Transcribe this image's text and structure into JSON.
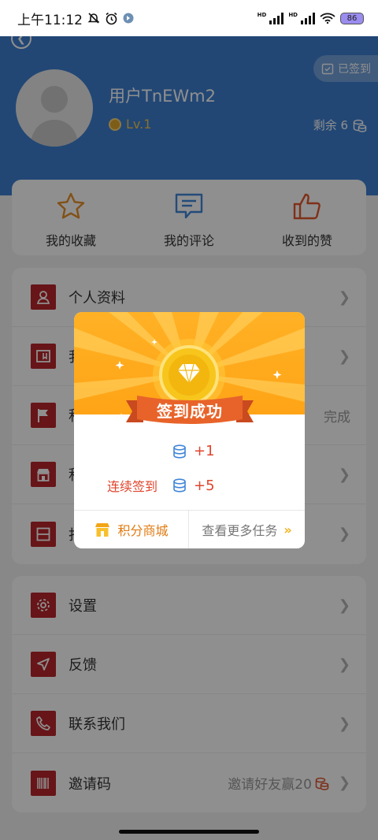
{
  "status_bar": {
    "time": "上午11:12",
    "battery": "86"
  },
  "profile": {
    "username": "用户TnEWm2",
    "level": "Lv.1",
    "checked_in_label": "已签到",
    "remaining_label": "剩余 6"
  },
  "quick_actions": [
    {
      "label": "我的收藏",
      "icon": "star-icon"
    },
    {
      "label": "我的评论",
      "icon": "comment-icon"
    },
    {
      "label": "收到的赞",
      "icon": "thumbs-up-icon"
    }
  ],
  "menu1": [
    {
      "label": "个人资料",
      "icon": "user-icon",
      "extra": ""
    },
    {
      "label": "我",
      "icon": "folder-icon",
      "extra": ""
    },
    {
      "label": "积",
      "icon": "flag-icon",
      "extra": "完成"
    },
    {
      "label": "积",
      "icon": "shop-icon",
      "extra": ""
    },
    {
      "label": "打",
      "icon": "square-icon",
      "extra": ""
    }
  ],
  "menu2": [
    {
      "label": "设置",
      "icon": "gear-icon",
      "extra": ""
    },
    {
      "label": "反馈",
      "icon": "send-icon",
      "extra": ""
    },
    {
      "label": "联系我们",
      "icon": "phone-icon",
      "extra": ""
    },
    {
      "label": "邀请码",
      "icon": "barcode-icon",
      "extra": "邀请好友赢20"
    }
  ],
  "dialog": {
    "title": "签到成功",
    "reward_daily": "+1",
    "streak_label": "连续签到",
    "reward_streak": "+5",
    "shop_button": "积分商城",
    "more_tasks_button": "查看更多任务",
    "more_arrow": "»"
  },
  "colors": {
    "header_blue": "#3e7fd0",
    "menu_red": "#b8262c",
    "gold": "#ffaa1a",
    "ribbon": "#e8632a"
  }
}
